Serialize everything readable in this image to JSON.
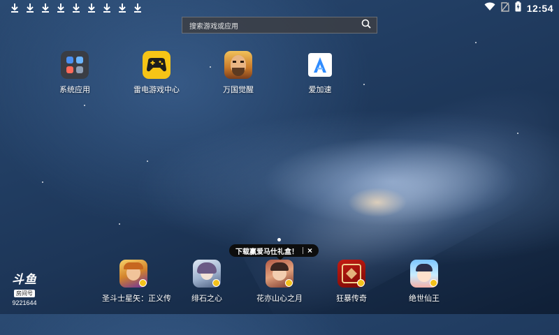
{
  "status_bar": {
    "download_icons": [
      "download-icon",
      "download-icon",
      "download-icon",
      "download-icon",
      "download-icon",
      "download-icon",
      "download-icon",
      "download-icon",
      "download-icon"
    ],
    "time": "12:54"
  },
  "search": {
    "placeholder": "搜索游戏或应用"
  },
  "desktop_apps": [
    {
      "label": "系统应用",
      "icon": "system-apps-folder"
    },
    {
      "label": "雷电游戏中心",
      "icon": "gamepad"
    },
    {
      "label": "万国觉醒",
      "icon": "rise-of-kingdoms"
    },
    {
      "label": "爱加速",
      "icon": "ai-accelerator"
    }
  ],
  "promo": {
    "text": "下载赢爱马仕礼盒！",
    "close": "×"
  },
  "dock_apps": [
    {
      "label": "圣斗士星矢：正义传"
    },
    {
      "label": "绯石之心"
    },
    {
      "label": "花亦山心之月"
    },
    {
      "label": "狂暴传奇"
    },
    {
      "label": "绝世仙王"
    }
  ],
  "watermark": {
    "logo": "斗鱼",
    "tag": "房间号",
    "room": "9221644"
  },
  "colors": {
    "accent_yellow": "#f4c21b",
    "search_bg": "#3c3e44"
  }
}
